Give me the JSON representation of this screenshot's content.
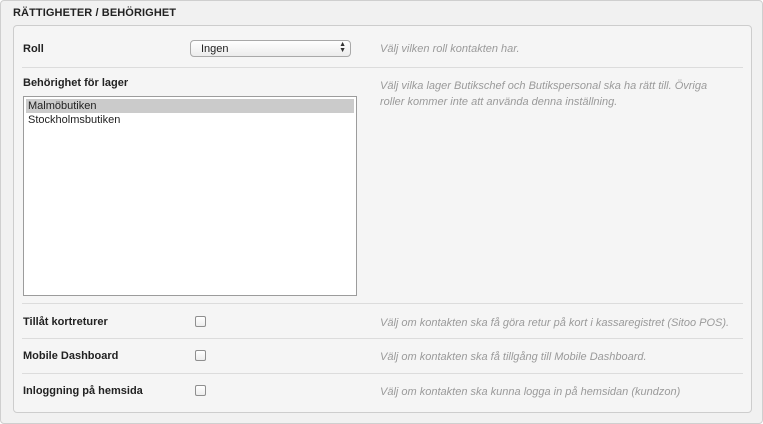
{
  "section": {
    "title": "RÄTTIGHETER / BEHÖRIGHET"
  },
  "role": {
    "label": "Roll",
    "selected": "Ingen",
    "help": "Välj vilken roll kontakten har."
  },
  "warehouse": {
    "label": "Behörighet för lager",
    "help": "Välj vilka lager Butikschef och Butikspersonal ska ha rätt till. Övriga roller kommer inte att använda denna inställning.",
    "items": [
      "Malmöbutiken",
      "Stockholmsbutiken"
    ],
    "selected_index": 0
  },
  "card_returns": {
    "label": "Tillåt kortreturer",
    "checked": false,
    "help": "Välj om kontakten ska få göra retur på kort i kassaregistret (Sitoo POS)."
  },
  "mobile_dashboard": {
    "label": "Mobile Dashboard",
    "checked": false,
    "help": "Välj om kontakten ska få tillgång till Mobile Dashboard."
  },
  "website_login": {
    "label": "Inloggning på hemsida",
    "checked": false,
    "help": "Välj om kontakten ska kunna logga in på hemsidan (kundzon)"
  }
}
